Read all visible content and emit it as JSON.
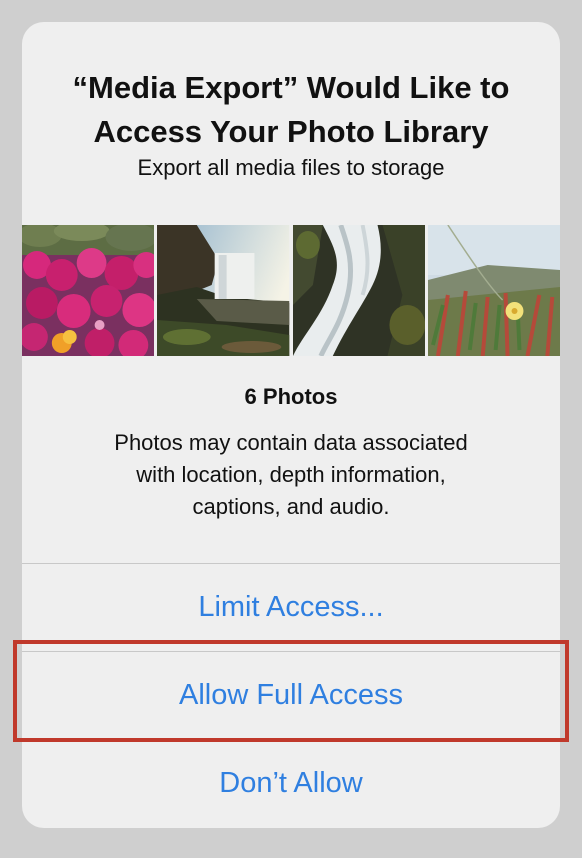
{
  "dialog": {
    "title_line1": "“Media Export” Would Like to",
    "title_line2": "Access Your Photo Library",
    "subtitle": "Export all media files to storage",
    "photos_count": "6 Photos",
    "info_line1": "Photos may contain data associated",
    "info_line2": "with location, depth information,",
    "info_line3": "captions, and audio.",
    "buttons": {
      "limit": "Limit Access...",
      "allow_full": "Allow Full Access",
      "dont_allow": "Don’t Allow"
    }
  },
  "colors": {
    "accent": "#2f7fe0",
    "highlight": "#c0392b",
    "dialog_bg": "#efefef",
    "backdrop": "#cfcfcf"
  },
  "photos": [
    {
      "name": "flowers-photo"
    },
    {
      "name": "waterfall-photo"
    },
    {
      "name": "cascade-photo"
    },
    {
      "name": "coastal-plants-photo"
    }
  ]
}
